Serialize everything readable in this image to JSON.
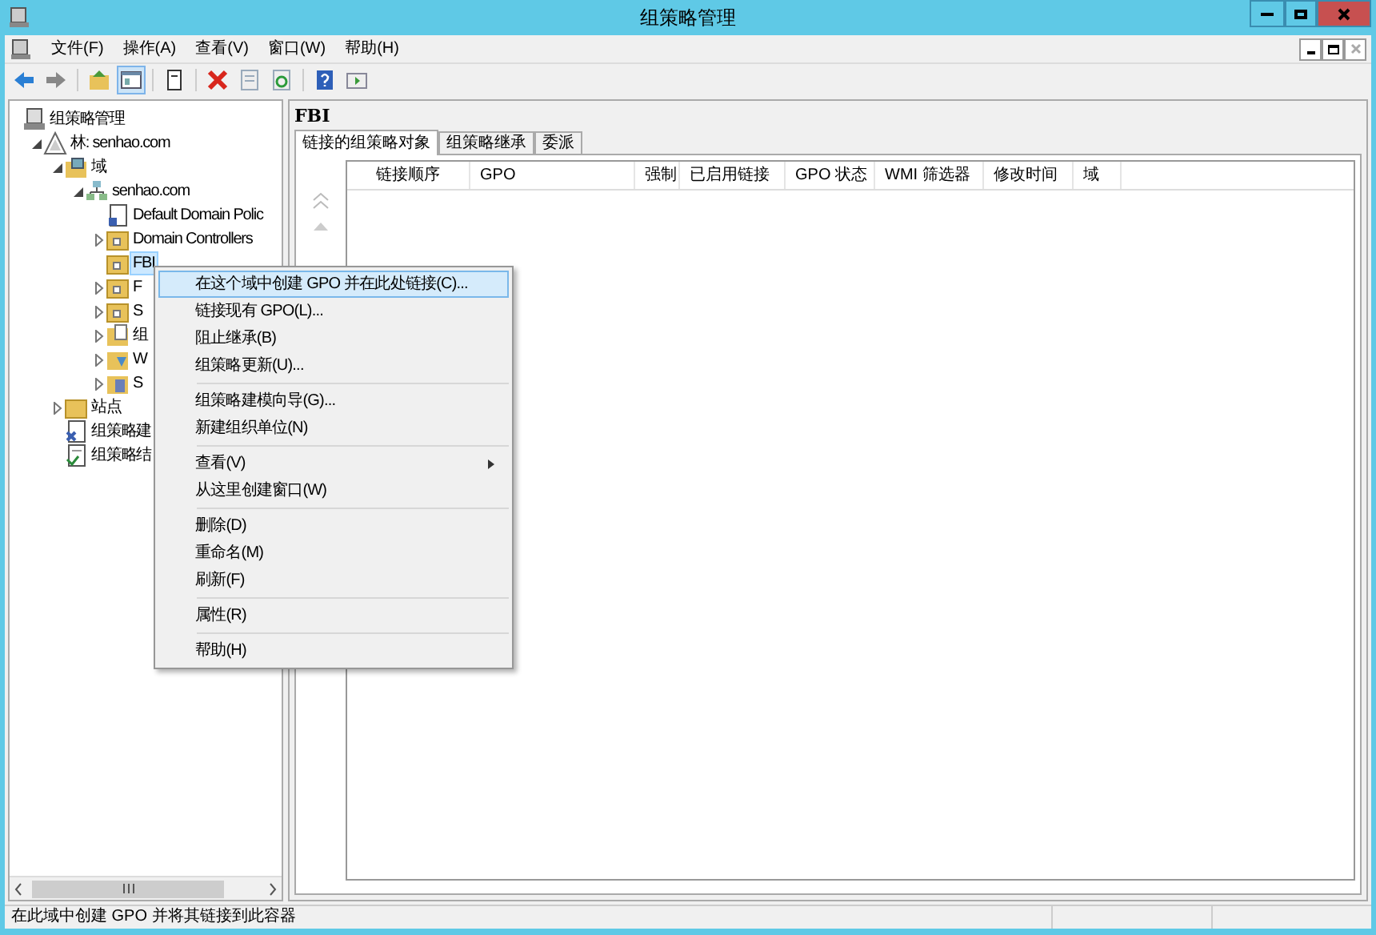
{
  "window": {
    "title": "组策略管理"
  },
  "menu_bar": [
    "文件(F)",
    "操作(A)",
    "查看(V)",
    "窗口(W)",
    "帮助(H)"
  ],
  "toolbar": [
    {
      "pressed": false
    },
    {
      "pressed": false
    },
    {
      "pressed": false
    },
    {
      "pressed": true
    },
    {
      "pressed": false
    },
    {
      "pressed": false
    },
    {
      "pressed": false
    },
    {
      "pressed": false
    },
    {
      "pressed": false
    },
    {
      "pressed": false
    }
  ],
  "tree": [
    {
      "label": "组策略管理",
      "kind": "root",
      "selected": false,
      "children": [
        {
          "label": "林: senhao.com",
          "kind": "forest",
          "expanded": true,
          "selected": false,
          "children": [
            {
              "label": "域",
              "kind": "domains",
              "expanded": true,
              "selected": false,
              "children": [
                {
                  "label": "senhao.com",
                  "kind": "domain",
                  "expanded": true,
                  "selected": false,
                  "children": [
                    {
                      "label": "Default Domain Polic",
                      "kind": "gpo",
                      "selected": false
                    },
                    {
                      "label": "Domain Controllers",
                      "kind": "ou",
                      "expanded": false,
                      "selected": false
                    },
                    {
                      "label": "FBI",
                      "kind": "ou",
                      "selected": true
                    },
                    {
                      "label": "F",
                      "kind": "ou",
                      "expanded": false,
                      "selected": false
                    },
                    {
                      "label": "S",
                      "kind": "ou",
                      "expanded": false,
                      "selected": false
                    },
                    {
                      "label": "组",
                      "kind": "gpo-folder",
                      "expanded": false,
                      "selected": false
                    },
                    {
                      "label": "W",
                      "kind": "wmi",
                      "expanded": false,
                      "selected": false
                    },
                    {
                      "label": "S",
                      "kind": "starter",
                      "expanded": false,
                      "selected": false
                    }
                  ]
                }
              ]
            },
            {
              "label": "站点",
              "kind": "folder",
              "expanded": false,
              "selected": false
            },
            {
              "label": "组策略建",
              "kind": "modeling",
              "selected": false
            },
            {
              "label": "组策略结",
              "kind": "results",
              "selected": false
            }
          ]
        }
      ]
    }
  ],
  "details": {
    "heading": "FBI",
    "tabs": [
      {
        "label": "链接的组策略对象",
        "selected": true
      },
      {
        "label": "组策略继承",
        "selected": false
      },
      {
        "label": "委派",
        "selected": false
      }
    ],
    "columns": [
      "链接顺序",
      "GPO",
      "强制",
      "已启用链接",
      "GPO 状态",
      "WMI 筛选器",
      "修改时间",
      "域"
    ]
  },
  "context_menu": [
    [
      {
        "label": "在这个域中创建 GPO 并在此处链接(C)...",
        "selected": true
      },
      {
        "label": "链接现有 GPO(L)...",
        "selected": false
      },
      {
        "label": "阻止继承(B)",
        "selected": false
      },
      {
        "label": "组策略更新(U)...",
        "selected": false
      }
    ],
    [
      {
        "label": "组策略建模向导(G)...",
        "selected": false
      },
      {
        "label": "新建组织单位(N)",
        "selected": false
      }
    ],
    [
      {
        "label": "查看(V)",
        "selected": false,
        "submenu": true
      },
      {
        "label": "从这里创建窗口(W)",
        "selected": false
      }
    ],
    [
      {
        "label": "删除(D)",
        "selected": false
      },
      {
        "label": "重命名(M)",
        "selected": false
      },
      {
        "label": "刷新(F)",
        "selected": false
      }
    ],
    [
      {
        "label": "属性(R)",
        "selected": false
      }
    ],
    [
      {
        "label": "帮助(H)",
        "selected": false
      }
    ]
  ],
  "status_bar": {
    "text": "在此域中创建 GPO 并将其链接到此容器"
  }
}
